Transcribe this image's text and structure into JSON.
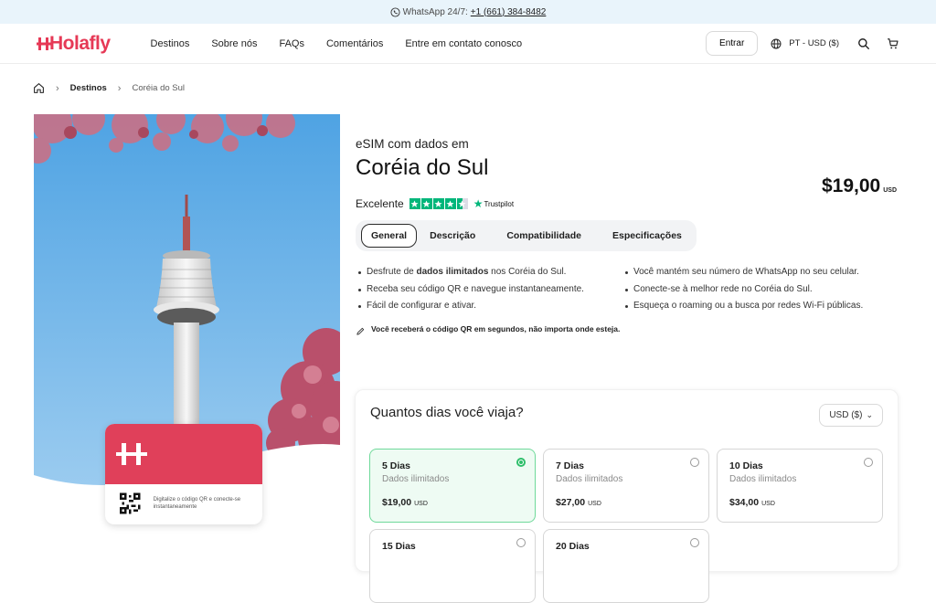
{
  "topbar": {
    "prefix": "WhatsApp 24/7:",
    "phone": "+1 (661) 384-8482",
    "icon": "whatsapp-icon"
  },
  "nav": {
    "logo": "Holafly",
    "links": [
      "Destinos",
      "Sobre nós",
      "FAQs",
      "Comentários",
      "Entre em contato conosco"
    ],
    "login": "Entrar",
    "locale": "PT - USD ($)"
  },
  "breadcrumb": [
    "Destinos",
    "Coréia do Sul"
  ],
  "hero_card": {
    "text": "Digitalize o código QR e conecte-se instantaneamente"
  },
  "product": {
    "subtitle": "eSIM com dados em",
    "title": "Coréia do Sul",
    "price": "$19,00",
    "price_currency": "USD",
    "rating_label": "Excelente",
    "rating_stars": 4.5,
    "rating_source": "Trustpilot"
  },
  "tabs": [
    "General",
    "Descrição",
    "Compatibilidade",
    "Especificações"
  ],
  "features_left": [
    {
      "pre": "Desfrute de ",
      "bold": "dados ilimitados",
      "post": " nos Coréia do Sul."
    },
    {
      "pre": "Receba seu código QR e navegue instantaneamente.",
      "bold": "",
      "post": ""
    },
    {
      "pre": "Fácil de configurar e ativar.",
      "bold": "",
      "post": ""
    }
  ],
  "features_right": [
    "Você mantém seu número de WhatsApp no seu celular.",
    "Conecte-se à melhor rede no Coréia do Sul.",
    "Esqueça o roaming ou a busca por redes Wi-Fi públicas."
  ],
  "note": "Você receberá o código QR em segundos, não importa onde esteja.",
  "picker": {
    "title": "Quantos dias você viaja?",
    "currency": "USD ($)",
    "plans": [
      {
        "days": "5 Dias",
        "data": "Dados ilimitados",
        "price": "$19,00",
        "unit": "USD",
        "selected": true
      },
      {
        "days": "7 Dias",
        "data": "Dados ilimitados",
        "price": "$27,00",
        "unit": "USD",
        "selected": false
      },
      {
        "days": "10 Dias",
        "data": "Dados ilimitados",
        "price": "$34,00",
        "unit": "USD",
        "selected": false
      },
      {
        "days": "15 Dias",
        "data": "",
        "price": "",
        "unit": "",
        "selected": false
      },
      {
        "days": "20 Dias",
        "data": "",
        "price": "",
        "unit": "",
        "selected": false
      }
    ]
  },
  "colors": {
    "brand": "#e63956",
    "accent_green": "#2fbf6b",
    "trustpilot": "#00b67a"
  }
}
